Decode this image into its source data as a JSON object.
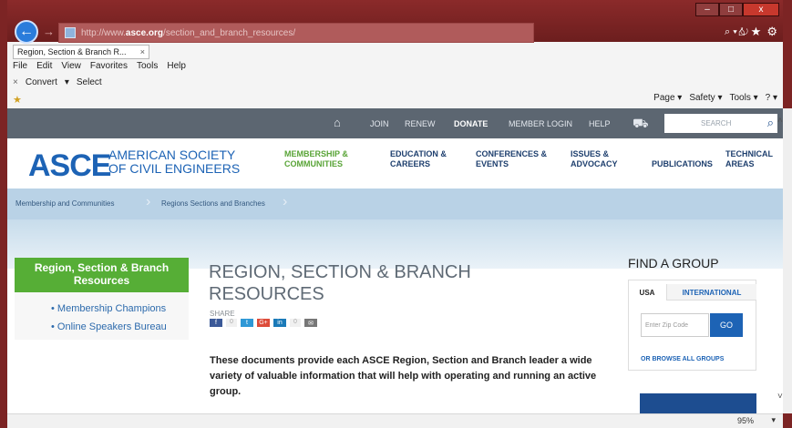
{
  "window": {
    "minimize": "‒",
    "maximize": "□",
    "close": "x"
  },
  "browser": {
    "back_icon": "←",
    "forward_icon": "→",
    "address_prefix": "http://www.",
    "address_domain": "asce.org",
    "address_path": "/section_and_branch_resources/",
    "address_tools": "⌕ ▾ ↻",
    "top_icons": "⌂★⚙",
    "tab_title": "Region, Section & Branch R...",
    "tab_close": "×",
    "menu": [
      "File",
      "Edit",
      "View",
      "Favorites",
      "Tools",
      "Help"
    ],
    "cmdbar": {
      "close": "×",
      "convert": "Convert",
      "convert_arrow": "▾",
      "select": "Select"
    },
    "right_cmds": {
      "page": "Page ▾",
      "safety": "Safety ▾",
      "tools": "Tools ▾",
      "help": "? ▾"
    },
    "fav_icon": "★"
  },
  "site": {
    "utility": {
      "home_icon": "⌂",
      "join": "JOIN",
      "renew": "RENEW",
      "donate": "DONATE",
      "member_login": "MEMBER LOGIN",
      "help": "HELP",
      "cart_icon": "⛟",
      "search_placeholder": "SEARCH",
      "search_icon": "⌕"
    },
    "logo": {
      "mark": "ASCE",
      "line1": "AMERICAN SOCIETY",
      "line2": "OF CIVIL ENGINEERS"
    },
    "nav": [
      {
        "line1": "MEMBERSHIP &",
        "line2": "COMMUNITIES"
      },
      {
        "line1": "EDUCATION &",
        "line2": "CAREERS"
      },
      {
        "line1": "CONFERENCES &",
        "line2": "EVENTS"
      },
      {
        "line1": "ISSUES &",
        "line2": "ADVOCACY"
      },
      {
        "line1": "PUBLICATIONS",
        "line2": ""
      },
      {
        "line1": "TECHNICAL",
        "line2": "AREAS"
      }
    ],
    "breadcrumb": [
      "Membership and Communities",
      "Regions Sections and Branches"
    ],
    "sidebar": {
      "title": "Region, Section & Branch Resources",
      "links": [
        "Membership Champions",
        "Online Speakers Bureau"
      ]
    },
    "main": {
      "title_line1": "REGION, SECTION & BRANCH",
      "title_line2": "RESOURCES",
      "share_label": "SHARE",
      "share": {
        "fb": "f",
        "tw": "t",
        "gp": "G+",
        "li": "in",
        "em": "✉",
        "count_fb": "0",
        "count_li": "0"
      },
      "intro": "These documents provide each ASCE Region, Section and Branch leader a wide variety of valuable information that will help with operating and running an active group."
    },
    "find_group": {
      "title": "FIND A GROUP",
      "tab_usa": "USA",
      "tab_intl": "INTERNATIONAL",
      "zip_placeholder": "Enter Zip Code",
      "go": "GO",
      "browse": "OR BROWSE ALL GROUPS"
    }
  },
  "status": {
    "zoom": "95%",
    "zoom_arrow": "▾"
  },
  "colors": {
    "accent_blue": "#1d63b5",
    "green": "#56ae36",
    "utility_bar": "#5c6671"
  }
}
